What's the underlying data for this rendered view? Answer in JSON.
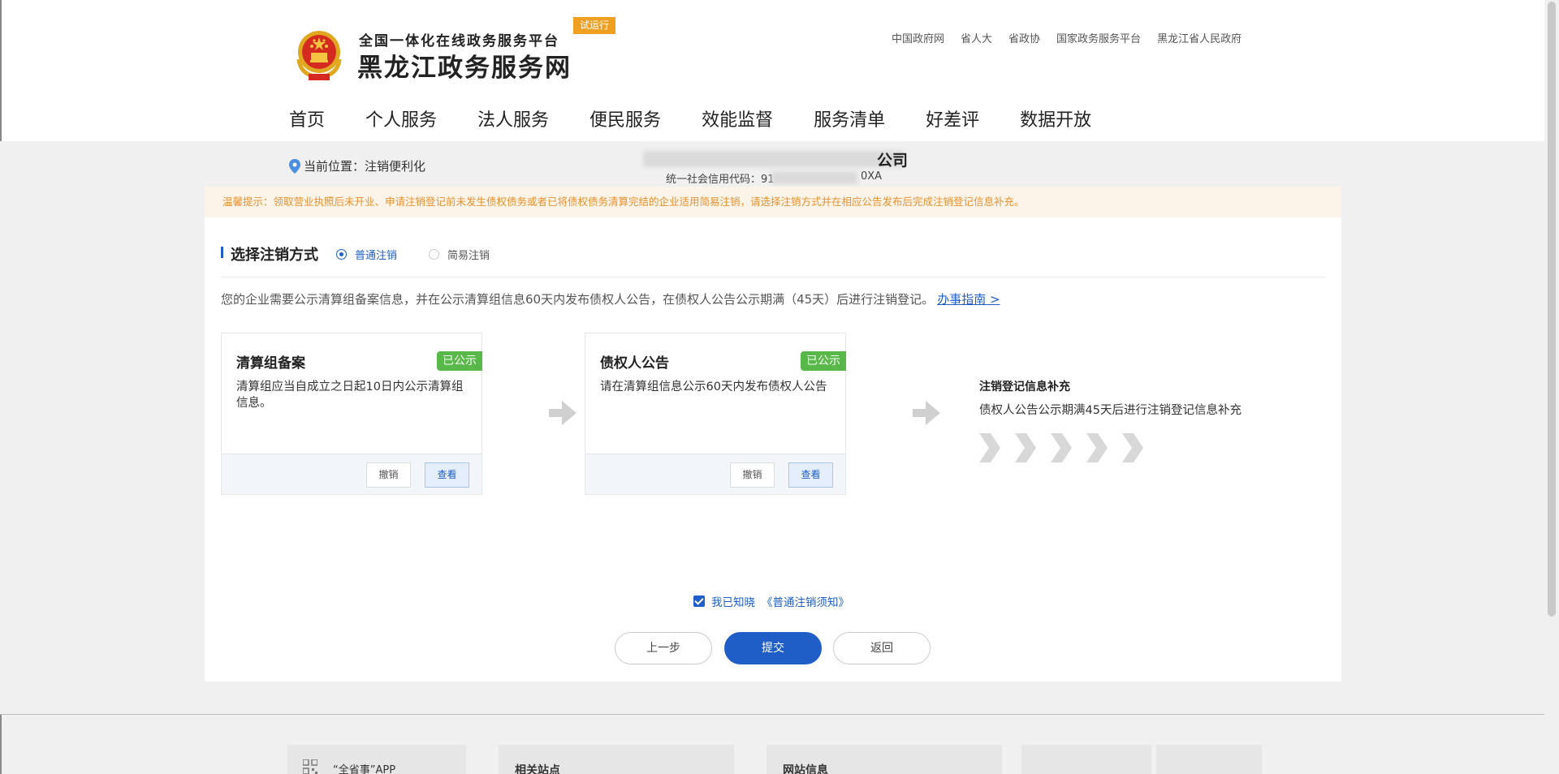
{
  "header": {
    "slogan": "全国一体化在线政务服务平台",
    "site_name": "黑龙江政务服务网",
    "trial_badge": "试运行",
    "top_links": [
      "中国政府网",
      "省人大",
      "省政协",
      "国家政务服务平台",
      "黑龙江省人民政府"
    ],
    "nav": [
      "首页",
      "个人服务",
      "法人服务",
      "便民服务",
      "效能监督",
      "服务清单",
      "好差评",
      "数据开放"
    ]
  },
  "location": {
    "label": "当前位置：注销便利化"
  },
  "company": {
    "name": "公司",
    "code_prefix": "统一社会信用代码：91",
    "code_suffix": "0XA"
  },
  "notice": "温馨提示：领取营业执照后未开业、申请注销登记前未发生债权债务或者已将债权债务清算完结的企业适用简易注销，请选择注销方式并在相应公告发布后完成注销登记信息补充。",
  "section": {
    "title": "选择注销方式",
    "options": [
      {
        "label": "普通注销",
        "checked": true
      },
      {
        "label": "简易注销",
        "checked": false
      }
    ]
  },
  "description": {
    "text": "您的企业需要公示清算组备案信息，并在公示清算组信息60天内发布债权人公告，在债权人公告公示期满（45天）后进行注销登记。",
    "guide_link": "办事指南 >"
  },
  "steps": [
    {
      "title": "清算组备案",
      "badge": "已公示",
      "text": "清算组应当自成立之日起10日内公示清算组信息。",
      "cancel_label": "撤销",
      "view_label": "查看"
    },
    {
      "title": "债权人公告",
      "badge": "已公示",
      "text": "请在清算组信息公示60天内发布债权人公告",
      "cancel_label": "撤销",
      "view_label": "查看"
    },
    {
      "title": "注销登记信息补充",
      "text": "债权人公告公示期满45天后进行注销登记信息补充"
    }
  ],
  "agreement": {
    "prefix": "我已知晓",
    "link": "《普通注销须知》",
    "checked": true
  },
  "actions": {
    "prev": "上一步",
    "submit": "提交",
    "back": "返回"
  },
  "footer": {
    "app_label": "“全省事”APP",
    "related_sites": "相关站点",
    "site_info": "网站信息"
  },
  "colors": {
    "primary": "#1f5ec6",
    "success_badge": "#59b84a",
    "notice_text": "#e8912d",
    "notice_bg": "#fdf4e9",
    "trial_badge": "#f0a020"
  }
}
